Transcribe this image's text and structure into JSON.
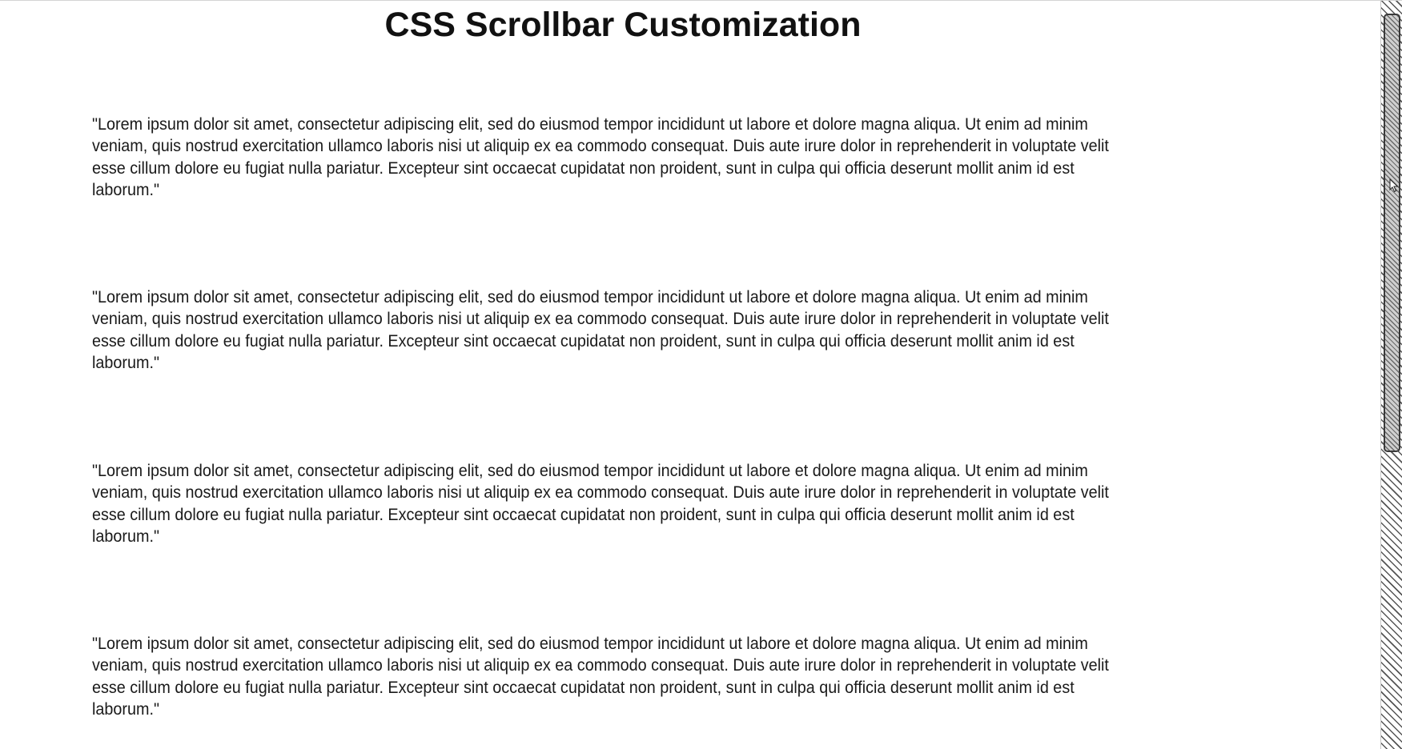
{
  "page": {
    "title": "CSS Scrollbar Customization"
  },
  "paragraphs": [
    "\"Lorem ipsum dolor sit amet, consectetur adipiscing elit, sed do eiusmod tempor incididunt ut labore et dolore magna aliqua. Ut enim ad minim veniam, quis nostrud exercitation ullamco laboris nisi ut aliquip ex ea commodo consequat. Duis aute irure dolor in reprehenderit in voluptate velit esse cillum dolore eu fugiat nulla pariatur. Excepteur sint occaecat cupidatat non proident, sunt in culpa qui officia deserunt mollit anim id est laborum.\"",
    "\"Lorem ipsum dolor sit amet, consectetur adipiscing elit, sed do eiusmod tempor incididunt ut labore et dolore magna aliqua. Ut enim ad minim veniam, quis nostrud exercitation ullamco laboris nisi ut aliquip ex ea commodo consequat. Duis aute irure dolor in reprehenderit in voluptate velit esse cillum dolore eu fugiat nulla pariatur. Excepteur sint occaecat cupidatat non proident, sunt in culpa qui officia deserunt mollit anim id est laborum.\"",
    "\"Lorem ipsum dolor sit amet, consectetur adipiscing elit, sed do eiusmod tempor incididunt ut labore et dolore magna aliqua. Ut enim ad minim veniam, quis nostrud exercitation ullamco laboris nisi ut aliquip ex ea commodo consequat. Duis aute irure dolor in reprehenderit in voluptate velit esse cillum dolore eu fugiat nulla pariatur. Excepteur sint occaecat cupidatat non proident, sunt in culpa qui officia deserunt mollit anim id est laborum.\"",
    "\"Lorem ipsum dolor sit amet, consectetur adipiscing elit, sed do eiusmod tempor incididunt ut labore et dolore magna aliqua. Ut enim ad minim veniam, quis nostrud exercitation ullamco laboris nisi ut aliquip ex ea commodo consequat. Duis aute irure dolor in reprehenderit in voluptate velit esse cillum dolore eu fugiat nulla pariatur. Excepteur sint occaecat cupidatat non proident, sunt in culpa qui officia deserunt mollit anim id est laborum.\""
  ],
  "scrollbar": {
    "style": "diagonal-stripes",
    "thumb_position_fraction": 0.0,
    "visible_fraction": 0.59,
    "track_color": "#ffffff",
    "stripe_color": "#555555",
    "thumb_border_color": "#3a3a3a"
  },
  "cursor": {
    "icon": "arrow-cursor-icon"
  }
}
